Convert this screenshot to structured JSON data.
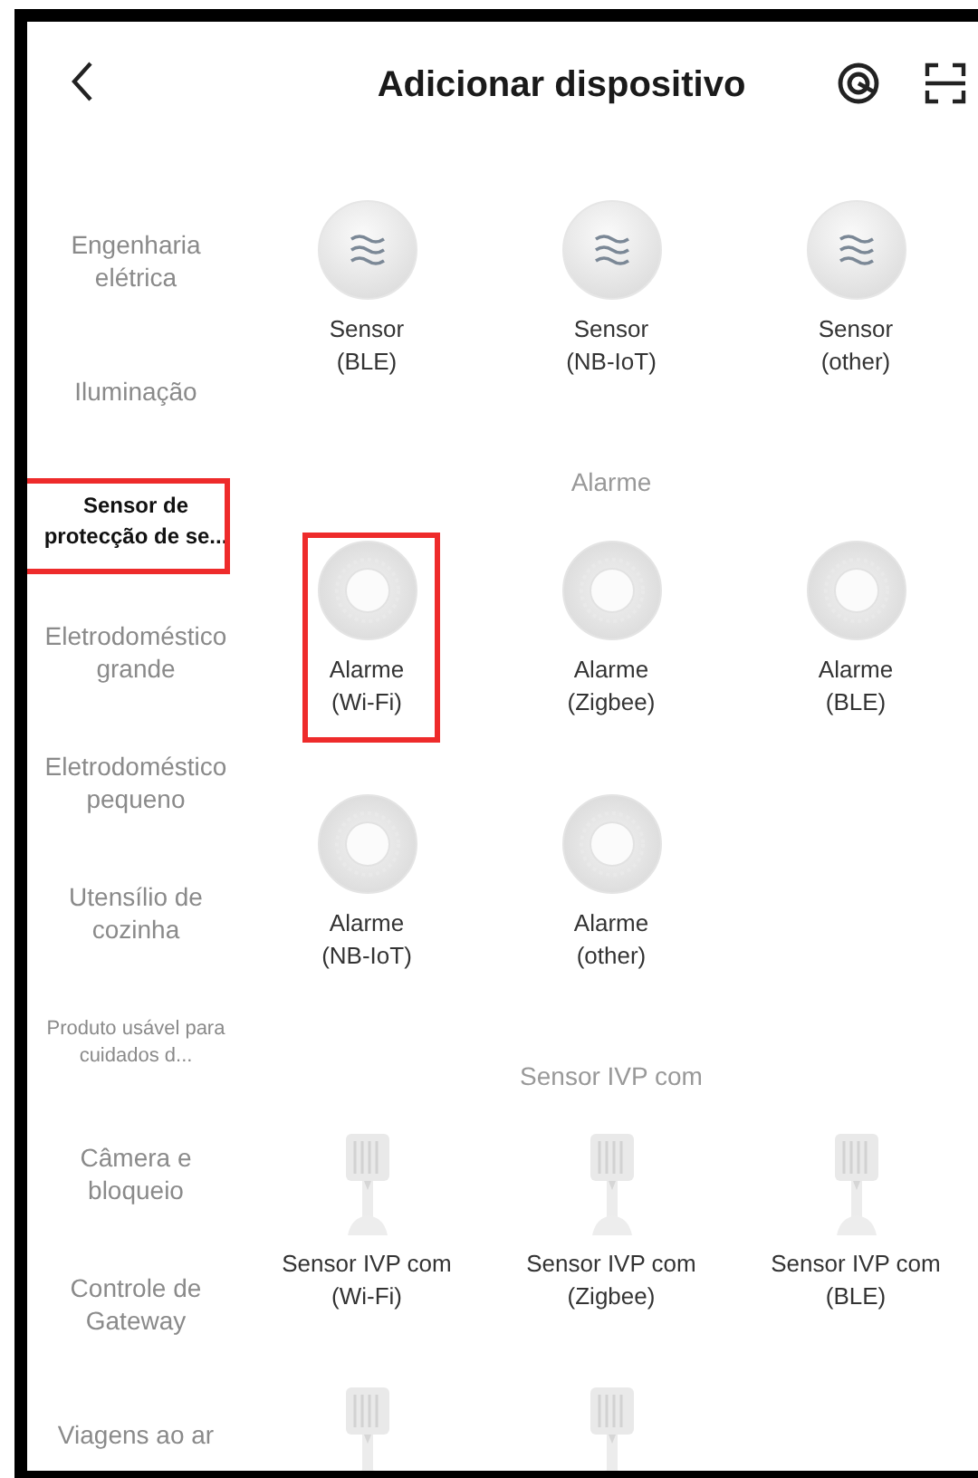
{
  "header": {
    "title": "Adicionar dispositivo"
  },
  "sidebar": {
    "items": [
      {
        "label": "Engenharia elétrica",
        "selected": false,
        "compact": false,
        "highlighted": false
      },
      {
        "label": "Iluminação",
        "selected": false,
        "compact": false,
        "highlighted": false
      },
      {
        "label": "Sensor de protecção de se...",
        "selected": true,
        "compact": false,
        "highlighted": true
      },
      {
        "label": "Eletrodoméstico grande",
        "selected": false,
        "compact": false,
        "highlighted": false
      },
      {
        "label": "Eletrodoméstico pequeno",
        "selected": false,
        "compact": false,
        "highlighted": false
      },
      {
        "label": "Utensílio de cozinha",
        "selected": false,
        "compact": false,
        "highlighted": false
      },
      {
        "label": "Produto usável para cuidados d...",
        "selected": false,
        "compact": true,
        "highlighted": false
      },
      {
        "label": "Câmera e bloqueio",
        "selected": false,
        "compact": false,
        "highlighted": false
      },
      {
        "label": "Controle de Gateway",
        "selected": false,
        "compact": false,
        "highlighted": false
      },
      {
        "label": "Viagens ao ar",
        "selected": false,
        "compact": false,
        "highlighted": false
      }
    ]
  },
  "sections": [
    {
      "devices": [
        {
          "kind": "water",
          "name": "Sensor",
          "protocol": "(BLE)",
          "highlighted": false
        },
        {
          "kind": "water",
          "name": "Sensor",
          "protocol": "(NB-IoT)",
          "highlighted": false
        },
        {
          "kind": "water",
          "name": "Sensor",
          "protocol": "(other)",
          "highlighted": false
        }
      ]
    },
    {
      "title": "Alarme",
      "devices": [
        {
          "kind": "alarm",
          "name": "Alarme",
          "protocol": "(Wi-Fi)",
          "highlighted": true
        },
        {
          "kind": "alarm",
          "name": "Alarme",
          "protocol": "(Zigbee)",
          "highlighted": false
        },
        {
          "kind": "alarm",
          "name": "Alarme",
          "protocol": "(BLE)",
          "highlighted": false
        },
        {
          "kind": "alarm",
          "name": "Alarme",
          "protocol": "(NB-IoT)",
          "highlighted": false
        },
        {
          "kind": "alarm",
          "name": "Alarme",
          "protocol": "(other)",
          "highlighted": false
        }
      ]
    },
    {
      "title": "Sensor IVP com",
      "devices": [
        {
          "kind": "pir",
          "name": "Sensor IVP com",
          "protocol": "(Wi-Fi)",
          "highlighted": false
        },
        {
          "kind": "pir",
          "name": "Sensor IVP com",
          "protocol": "(Zigbee)",
          "highlighted": false
        },
        {
          "kind": "pir",
          "name": "Sensor IVP com",
          "protocol": "(BLE)",
          "highlighted": false
        },
        {
          "kind": "pir",
          "highlighted": false
        },
        {
          "kind": "pir",
          "highlighted": false
        }
      ]
    }
  ]
}
